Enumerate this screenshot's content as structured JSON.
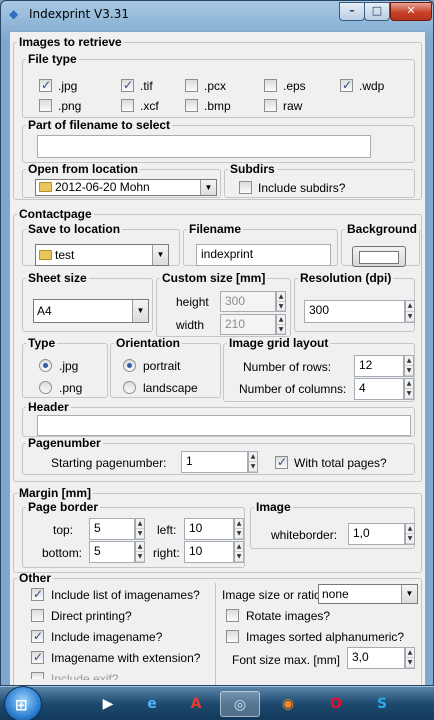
{
  "window": {
    "title": "Indexprint V3.31",
    "min": "–",
    "max": "□",
    "close": "✕"
  },
  "images": {
    "legend": "Images to retrieve",
    "filetype": {
      "legend": "File type",
      "items": [
        {
          "label": ".jpg",
          "checked": true
        },
        {
          "label": ".tif",
          "checked": true
        },
        {
          "label": ".pcx",
          "checked": false
        },
        {
          "label": ".eps",
          "checked": false
        },
        {
          "label": ".wdp",
          "checked": true
        },
        {
          "label": ".png",
          "checked": false
        },
        {
          "label": ".xcf",
          "checked": false
        },
        {
          "label": ".bmp",
          "checked": false
        },
        {
          "label": "raw",
          "checked": false
        }
      ]
    },
    "part": {
      "legend": "Part of filename to select",
      "value": ""
    },
    "open": {
      "legend": "Open from location",
      "value": "2012-06-20 Mohn"
    },
    "subdirs": {
      "legend": "Subdirs",
      "label": "Include subdirs?",
      "checked": false
    }
  },
  "contact": {
    "legend": "Contactpage",
    "save": {
      "legend": "Save to location",
      "value": "test"
    },
    "filename": {
      "legend": "Filename",
      "value": "indexprint"
    },
    "background": {
      "legend": "Background",
      "color": "#ffffff"
    },
    "sheet": {
      "legend": "Sheet size",
      "value": "A4"
    },
    "custom": {
      "legend": "Custom size [mm]",
      "height_label": "height",
      "height": "300",
      "width_label": "width",
      "width": "210"
    },
    "resolution": {
      "legend": "Resolution (dpi)",
      "value": "300"
    },
    "type": {
      "legend": "Type",
      "opt1": ".jpg",
      "opt2": ".png",
      "selected": ".jpg"
    },
    "orientation": {
      "legend": "Orientation",
      "opt1": "portrait",
      "opt2": "landscape",
      "selected": "portrait"
    },
    "grid": {
      "legend": "Image grid layout",
      "rows_label": "Number of rows:",
      "rows": "12",
      "cols_label": "Number of columns:",
      "cols": "4"
    },
    "header": {
      "legend": "Header",
      "value": ""
    },
    "pagenumber": {
      "legend": "Pagenumber",
      "start_label": "Starting pagenumber:",
      "start": "1",
      "total_label": "With total pages?",
      "total_checked": true
    }
  },
  "margin": {
    "legend": "Margin [mm]",
    "border": {
      "legend": "Page border",
      "top_label": "top:",
      "top": "5",
      "left_label": "left:",
      "left": "10",
      "bottom_label": "bottom:",
      "bottom": "5",
      "right_label": "right:",
      "right": "10"
    },
    "image": {
      "legend": "Image",
      "white_label": "whiteborder:",
      "white": "1,0"
    }
  },
  "other": {
    "legend": "Other",
    "left": [
      {
        "label": "Include list of imagenames?",
        "checked": true
      },
      {
        "label": "Direct printing?",
        "checked": false
      },
      {
        "label": "Include imagename?",
        "checked": true
      },
      {
        "label": "Imagename with extension?",
        "checked": true
      },
      {
        "label": "Include exif?",
        "checked": false
      }
    ],
    "ratio_label": "Image size or ratio",
    "ratio_value": "none",
    "rotate": {
      "label": "Rotate images?",
      "checked": false
    },
    "sorted": {
      "label": "Images sorted alphanumeric?",
      "checked": false
    },
    "font_label": "Font size max. [mm]",
    "font_value": "3,0"
  },
  "taskbar": {
    "items": [
      {
        "name": "media-player-icon",
        "glyph": "▶",
        "color": "#ffffff"
      },
      {
        "name": "internet-explorer-icon",
        "glyph": "e",
        "color": "#4fb3ff"
      },
      {
        "name": "pdf-reader-icon",
        "glyph": "A",
        "color": "#e53b2c"
      },
      {
        "name": "app-icon",
        "glyph": "◎",
        "color": "#cfe6ff"
      },
      {
        "name": "firefox-icon",
        "glyph": "◉",
        "color": "#ff8a1d"
      },
      {
        "name": "opera-icon",
        "glyph": "O",
        "color": "#e8102e"
      },
      {
        "name": "skype-icon",
        "glyph": "S",
        "color": "#29a8e6"
      }
    ]
  }
}
